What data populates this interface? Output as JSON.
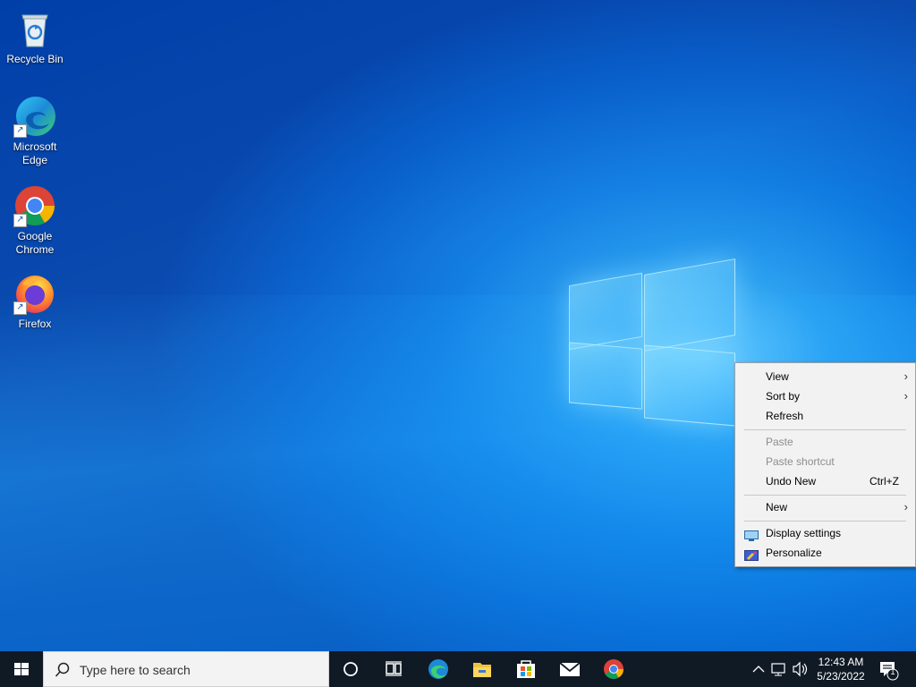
{
  "desktop": {
    "icons": [
      {
        "label": "Recycle Bin",
        "icon": "recycle-bin-icon"
      },
      {
        "label": "Microsoft Edge",
        "icon": "edge-icon"
      },
      {
        "label": "Google Chrome",
        "icon": "chrome-icon"
      },
      {
        "label": "Firefox",
        "icon": "firefox-icon"
      }
    ]
  },
  "context_menu": {
    "items": [
      {
        "label": "View",
        "submenu": true,
        "enabled": true
      },
      {
        "label": "Sort by",
        "submenu": true,
        "enabled": true
      },
      {
        "label": "Refresh",
        "enabled": true
      },
      {
        "label": "Paste",
        "enabled": false
      },
      {
        "label": "Paste shortcut",
        "enabled": false
      },
      {
        "label": "Undo New",
        "shortcut": "Ctrl+Z",
        "enabled": true
      },
      {
        "label": "New",
        "submenu": true,
        "enabled": true
      },
      {
        "label": "Display settings",
        "icon": "display-icon",
        "enabled": true
      },
      {
        "label": "Personalize",
        "icon": "personalize-icon",
        "enabled": true
      }
    ]
  },
  "taskbar": {
    "search_placeholder": "Type here to search",
    "pinned": [
      "cortana-icon",
      "task-view-icon",
      "edge-icon",
      "file-explorer-icon",
      "store-icon",
      "mail-icon",
      "chrome-icon"
    ],
    "clock": {
      "time": "12:43 AM",
      "date": "5/23/2022"
    },
    "notification_count": "1"
  },
  "colors": {
    "accent": "#0078d7",
    "taskbar": "#101a25",
    "menu_bg": "#f2f2f2"
  }
}
